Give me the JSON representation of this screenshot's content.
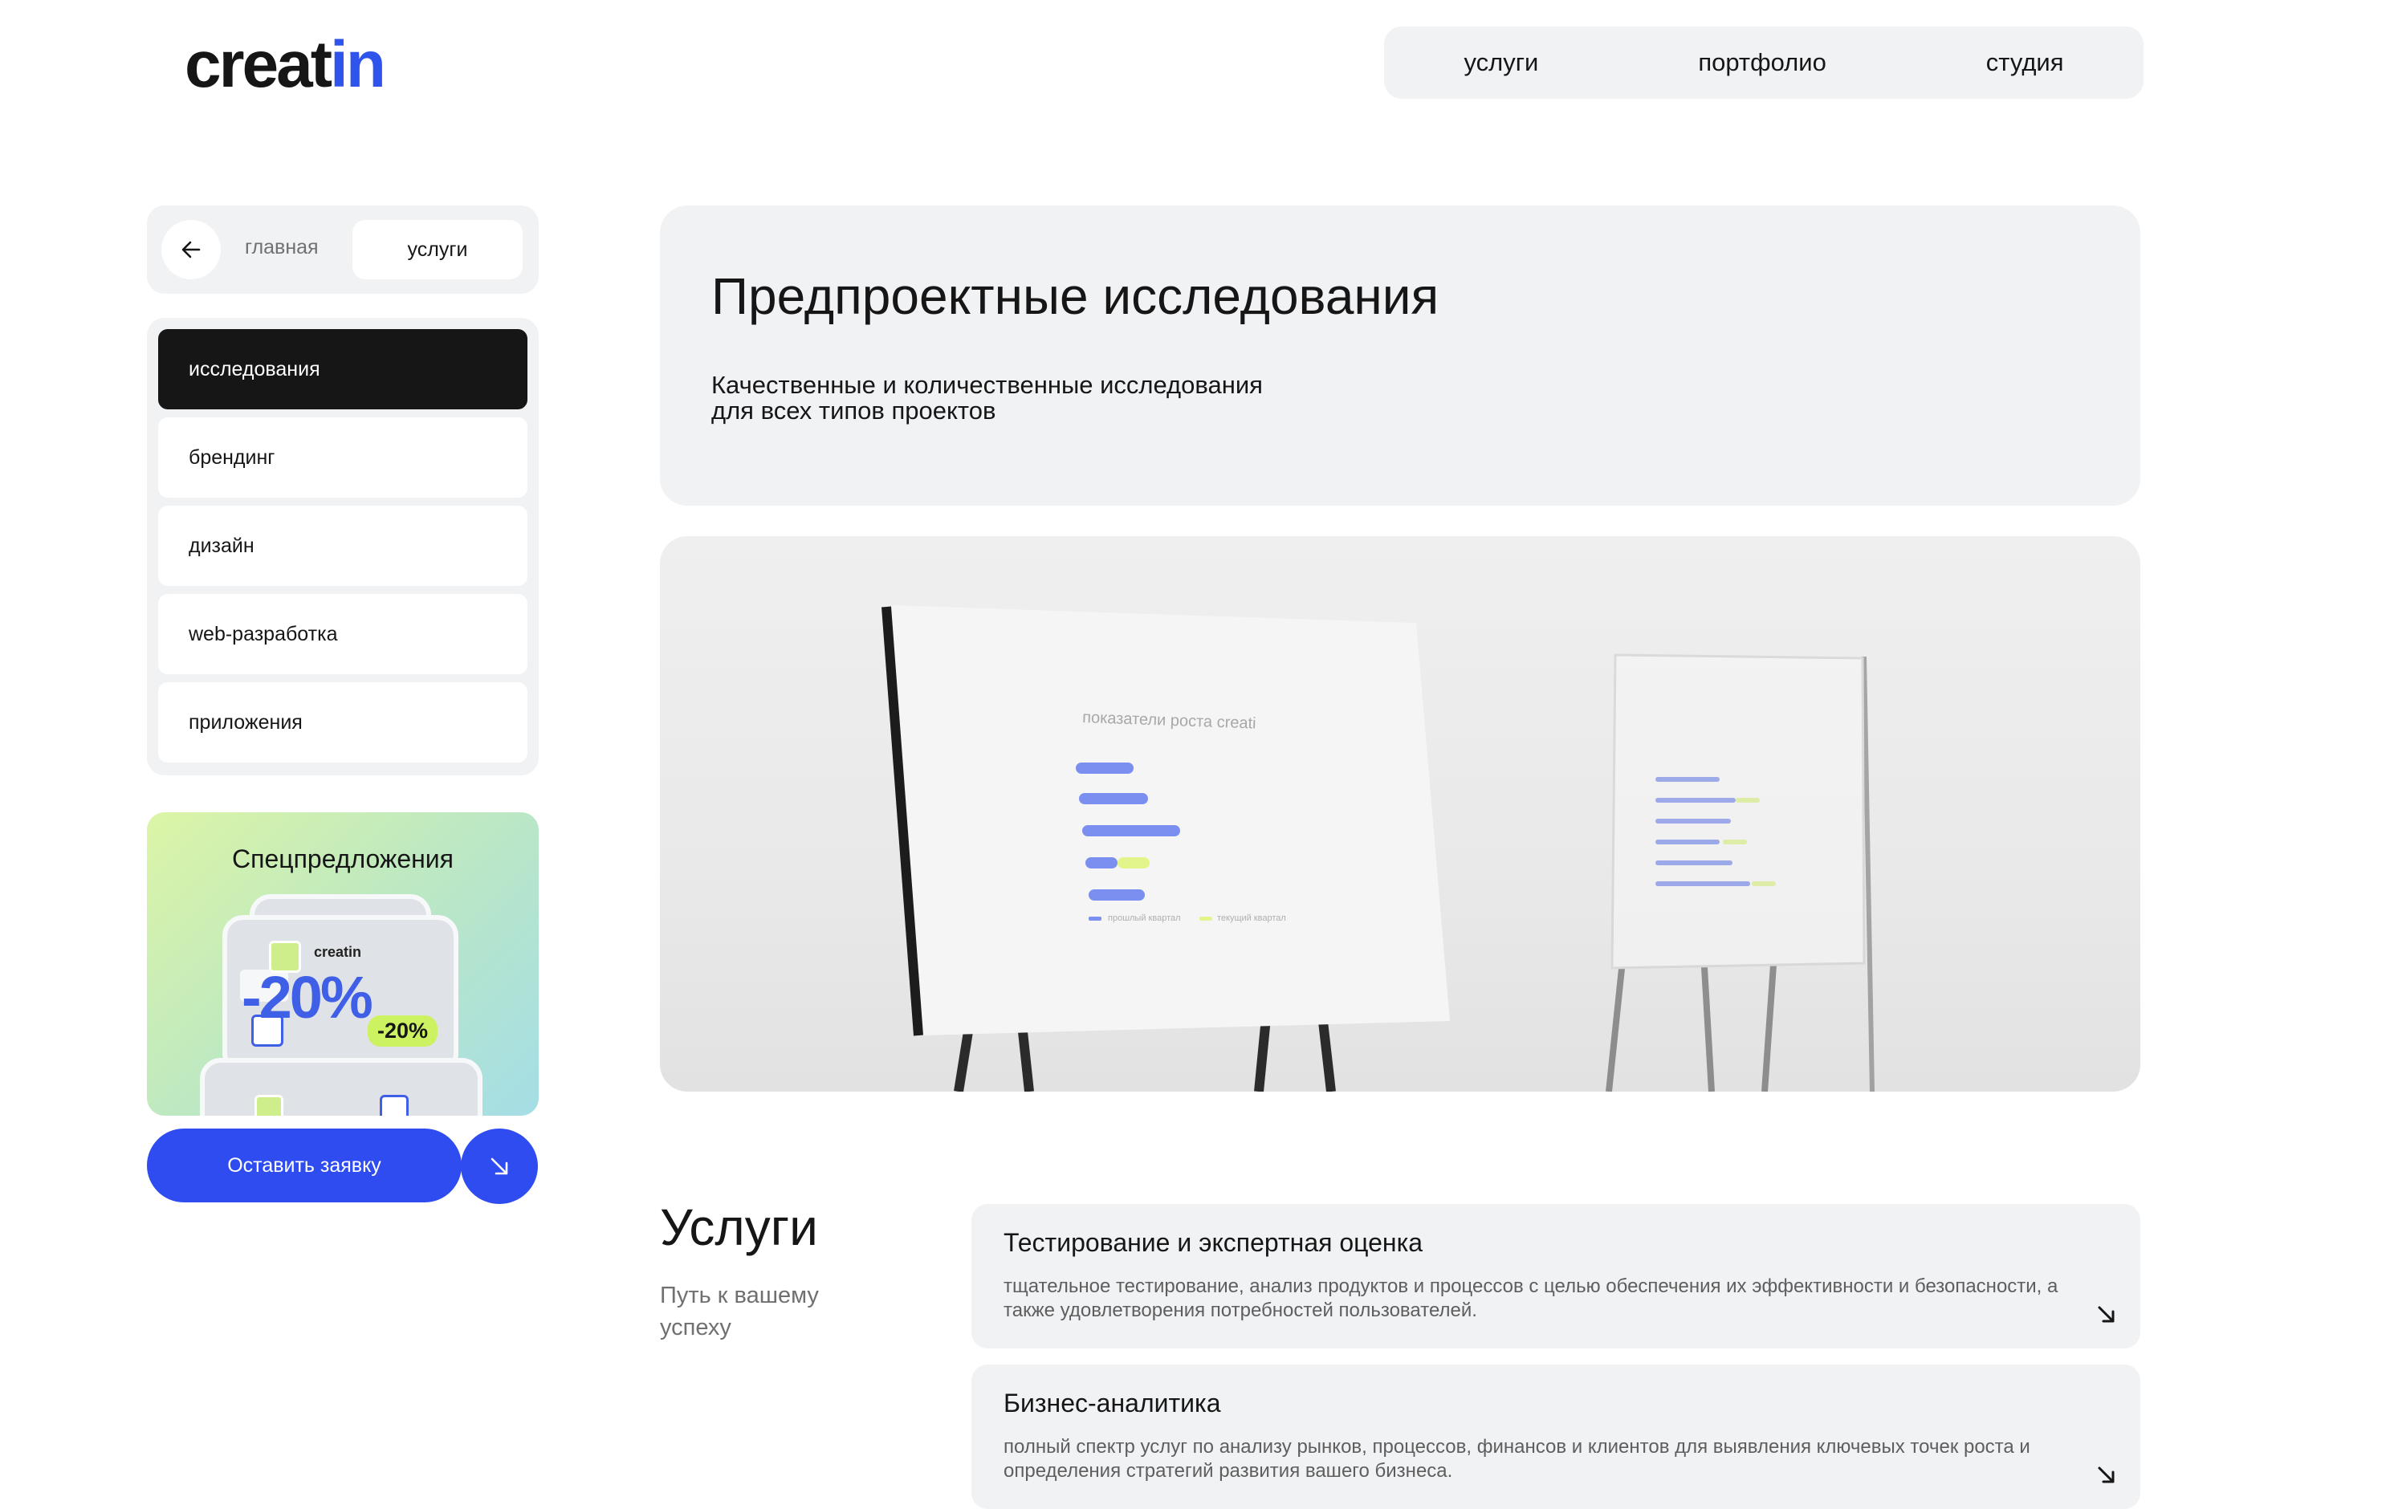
{
  "logo": {
    "main": "creat",
    "accent": "in"
  },
  "nav": [
    {
      "label": "услуги"
    },
    {
      "label": "портфолио"
    },
    {
      "label": "студия"
    }
  ],
  "breadcrumb": {
    "home": "главная",
    "current": "услуги",
    "back_icon": "arrow-left-icon"
  },
  "sidebar": {
    "items": [
      {
        "label": "исследования",
        "active": true
      },
      {
        "label": "брендинг",
        "active": false
      },
      {
        "label": "дизайн",
        "active": false
      },
      {
        "label": "web-разработка",
        "active": false
      },
      {
        "label": "приложения",
        "active": false
      }
    ]
  },
  "promo": {
    "title": "Спецпредложения",
    "big_discount": "-20%",
    "chip": "-20%",
    "brand": "creatin"
  },
  "cta": {
    "label": "Оставить заявку",
    "icon": "arrow-down-right-icon"
  },
  "hero": {
    "title": "Предпроектные исследования",
    "subtitle": "Качественные и количественные исследования для всех типов проектов"
  },
  "image": {
    "board_title": "показатели роста creati",
    "legend": [
      "прошлый квартал",
      "текущий квартал"
    ]
  },
  "services": {
    "heading": "Услуги",
    "subheading": "Путь к вашему успеху",
    "items": [
      {
        "title": "Тестирование и экспертная оценка",
        "desc": "тщательное тестирование, анализ продуктов и процессов с целью обеспечения их эффективности и безопасности, а также удовлетворения потребностей пользователей."
      },
      {
        "title": "Бизнес-аналитика",
        "desc": "полный спектр услуг по анализу рынков, процессов, финансов и клиентов для выявления ключевых точек роста и определения стратегий развития вашего бизнеса."
      }
    ]
  },
  "colors": {
    "accent": "#2e4cf0",
    "panel": "#f1f2f4",
    "lime": "#ccf261",
    "dark": "#161616"
  }
}
